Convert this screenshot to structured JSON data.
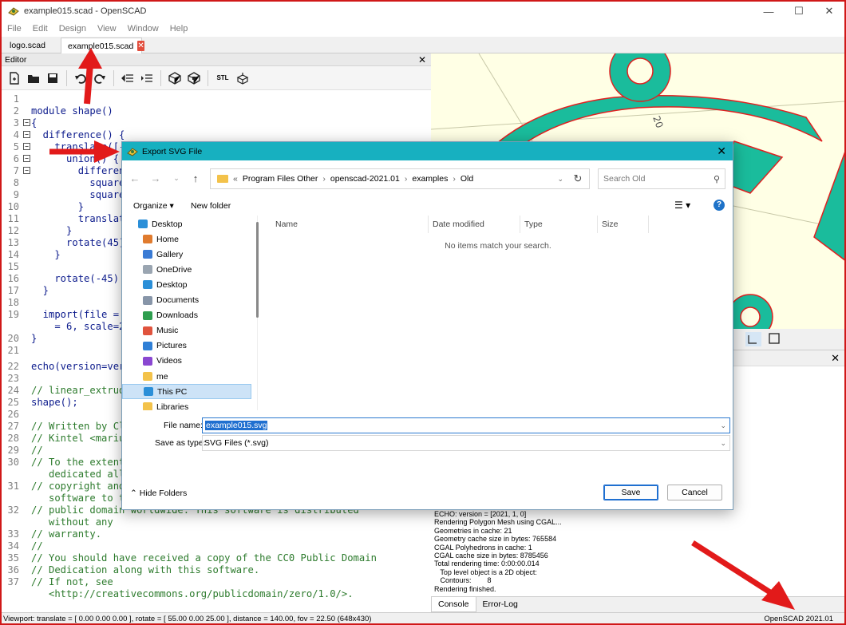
{
  "app": {
    "title": "example015.scad - OpenSCAD",
    "window_controls": [
      "minimize-icon",
      "maximize-icon",
      "close-icon"
    ]
  },
  "menu": [
    "File",
    "Edit",
    "Design",
    "View",
    "Window",
    "Help"
  ],
  "tabs": [
    {
      "label": "logo.scad",
      "active": false
    },
    {
      "label": "example015.scad",
      "active": true,
      "close_icon": "close-icon"
    }
  ],
  "editor": {
    "header": "Editor",
    "toolbar_icons": [
      "new-file-icon",
      "open-file-icon",
      "save-icon",
      "undo-icon",
      "redo-icon",
      "unindent-icon",
      "indent-icon",
      "preview-icon",
      "render-icon",
      "export-stl-icon",
      "send-to-print-icon"
    ],
    "export_stl_text": "STL",
    "lines": [
      {
        "n": "1",
        "text": ""
      },
      {
        "n": "2",
        "text": "module shape()"
      },
      {
        "n": "3",
        "text": "{",
        "fold": true
      },
      {
        "n": "4",
        "text": "  difference() {",
        "fold": true
      },
      {
        "n": "5",
        "text": "    translate([-35, -35]) intersection() {",
        "fold": true
      },
      {
        "n": "6",
        "text": "      union() {",
        "fold": true
      },
      {
        "n": "7",
        "text": "        difference() {",
        "fold": true
      },
      {
        "n": "8",
        "text": "          square(100, true);"
      },
      {
        "n": "9",
        "text": "          square(50, true);"
      },
      {
        "n": "10",
        "text": "        }"
      },
      {
        "n": "11",
        "text": "        translate([50, 50]) circle(15);"
      },
      {
        "n": "12",
        "text": "      }"
      },
      {
        "n": "13",
        "text": "      rotate(45) translate([0, -15]) square([100, 30]);"
      },
      {
        "n": "14",
        "text": "    }"
      },
      {
        "n": "15",
        "text": ""
      },
      {
        "n": "16",
        "text": "    rotate(-45) scale([0.7, 1.3]) circle(5);"
      },
      {
        "n": "17",
        "text": "  }"
      },
      {
        "n": "18",
        "text": ""
      },
      {
        "n": "19",
        "text": "  import(file = \"example009.dxf\", layer = \"body\", convexity"
      },
      {
        "n": "",
        "text": "    = 6, scale=2);"
      },
      {
        "n": "20",
        "text": "}"
      },
      {
        "n": "21",
        "text": ""
      },
      {
        "n": "22",
        "text": "echo(version=version());"
      },
      {
        "n": "23",
        "text": ""
      },
      {
        "n": "24",
        "text": "// linear_extrude(height = 10)",
        "comment": true
      },
      {
        "n": "25",
        "text": "shape();"
      },
      {
        "n": "26",
        "text": ""
      },
      {
        "n": "27",
        "text": "// Written by Clifford Wolf <clifford@clifford.at> and Marius",
        "comment": true
      },
      {
        "n": "28",
        "text": "// Kintel <marius@kintel.net>",
        "comment": true
      },
      {
        "n": "29",
        "text": "//",
        "comment": true
      },
      {
        "n": "30",
        "text": "// To the extent possible under law, the author(s) have",
        "comment": true
      },
      {
        "n": "",
        "text": "   dedicated all",
        "comment": true
      },
      {
        "n": "31",
        "text": "// copyright and related and neighboring rights to this",
        "comment": true
      },
      {
        "n": "",
        "text": "   software to the",
        "comment": true
      },
      {
        "n": "32",
        "text": "// public domain worldwide. This software is distributed",
        "comment": true
      },
      {
        "n": "",
        "text": "   without any",
        "comment": true
      },
      {
        "n": "33",
        "text": "// warranty.",
        "comment": true
      },
      {
        "n": "34",
        "text": "//",
        "comment": true
      },
      {
        "n": "35",
        "text": "// You should have received a copy of the CC0 Public Domain",
        "comment": true
      },
      {
        "n": "36",
        "text": "// Dedication along with this software.",
        "comment": true
      },
      {
        "n": "37",
        "text": "// If not, see",
        "comment": true
      },
      {
        "n": "",
        "text": "   <http://creativecommons.org/publicdomain/zero/1.0/>.",
        "comment": true
      }
    ]
  },
  "viewport": {
    "bg_color": "#ffffe5",
    "shape_color": "#1abc9c",
    "outline_color": "#e02020",
    "axis_label": "20"
  },
  "console": {
    "lines": [
      "ECHO: version = [2021, 1, 0]",
      "Rendering Polygon Mesh using CGAL...",
      "Geometries in cache: 21",
      "Geometry cache size in bytes: 765584",
      "CGAL Polyhedrons in cache: 1",
      "CGAL cache size in bytes: 8785456",
      "Total rendering time: 0:00:00.014",
      "   Top level object is a 2D object:",
      "   Contours:        8",
      "Rendering finished."
    ],
    "tabs": [
      "Console",
      "Error-Log"
    ]
  },
  "status": {
    "viewport": "Viewport: translate = [ 0.00 0.00 0.00 ], rotate = [ 55.00 0.00 25.00 ], distance = 140.00, fov = 22.50 (648x430)",
    "version": "OpenSCAD 2021.01"
  },
  "dialog": {
    "title": "Export SVG File",
    "breadcrumb": [
      "Program Files Other",
      "openscad-2021.01",
      "examples",
      "Old"
    ],
    "breadcrumb_prefix": "«",
    "search_placeholder": "Search Old",
    "organize": "Organize ▾",
    "new_folder": "New folder",
    "nav_items": [
      {
        "label": "Desktop",
        "icon": "desktop-icon",
        "color": "#2b8fd8"
      },
      {
        "label": "Home",
        "icon": "home-icon",
        "color": "#e07b2e"
      },
      {
        "label": "Gallery",
        "icon": "gallery-icon",
        "color": "#3a7bd5"
      },
      {
        "label": "OneDrive",
        "icon": "document-icon",
        "color": "#9aa5b1"
      },
      {
        "label": "Desktop",
        "icon": "desktop-icon",
        "color": "#2b8fd8"
      },
      {
        "label": "Documents",
        "icon": "documents-icon",
        "color": "#8795a8"
      },
      {
        "label": "Downloads",
        "icon": "downloads-icon",
        "color": "#2e9e4f"
      },
      {
        "label": "Music",
        "icon": "music-icon",
        "color": "#e0533d"
      },
      {
        "label": "Pictures",
        "icon": "pictures-icon",
        "color": "#2f7fd6"
      },
      {
        "label": "Videos",
        "icon": "videos-icon",
        "color": "#8a47d1"
      },
      {
        "label": "me",
        "icon": "folder-icon",
        "color": "#f3c24a"
      },
      {
        "label": "This PC",
        "icon": "computer-icon",
        "color": "#2b8fd8",
        "selected": true
      },
      {
        "label": "Libraries",
        "icon": "folder-icon",
        "color": "#f3c24a"
      }
    ],
    "columns": [
      "Name",
      "Date modified",
      "Type",
      "Size"
    ],
    "empty_text": "No items match your search.",
    "file_name_label": "File name:",
    "file_name": "example015.svg",
    "save_type_label": "Save as type:",
    "save_type": "SVG Files (*.svg)",
    "hide_folders": "Hide Folders",
    "save": "Save",
    "cancel": "Cancel"
  },
  "annotation_color": "#e21a1a"
}
